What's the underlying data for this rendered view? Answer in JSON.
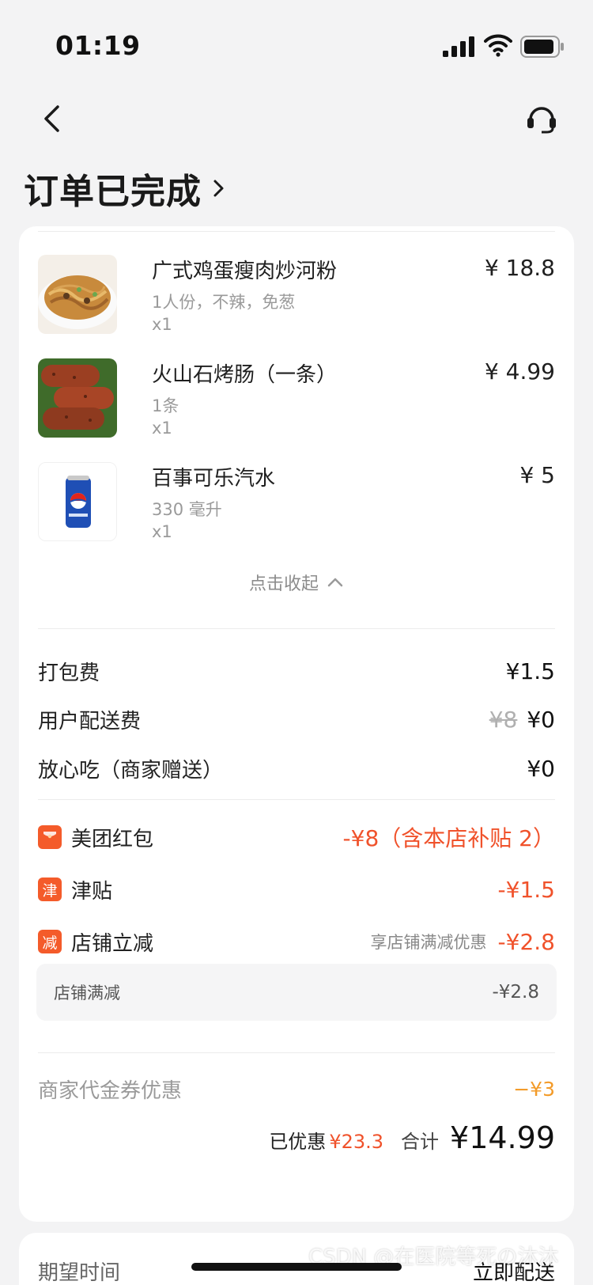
{
  "status_bar": {
    "time": "01:19"
  },
  "header": {
    "title": "订单已完成"
  },
  "items": [
    {
      "name": "广式鸡蛋瘦肉炒河粉",
      "spec": "1人份，不辣，免葱",
      "qty": "x1",
      "price": "¥ 18.8"
    },
    {
      "name": "火山石烤肠（一条）",
      "spec": "1条",
      "qty": "x1",
      "price": "¥ 4.99"
    },
    {
      "name": "百事可乐汽水",
      "spec": "330 毫升",
      "qty": "x1",
      "price": "¥ 5"
    }
  ],
  "collapse_label": "点击收起",
  "fees": [
    {
      "label": "打包费",
      "original": "",
      "value": "¥1.5"
    },
    {
      "label": "用户配送费",
      "original": "¥8",
      "value": "¥0"
    },
    {
      "label": "放心吃（商家赠送）",
      "original": "",
      "value": "¥0"
    }
  ],
  "discounts": [
    {
      "badge": "",
      "label": "美团红包",
      "note": "",
      "amount": "-¥8（含本店补贴 2）"
    },
    {
      "badge": "津",
      "label": "津贴",
      "note": "",
      "amount": "-¥1.5"
    },
    {
      "badge": "减",
      "label": "店铺立减",
      "note": "享店铺满减优惠",
      "amount": "-¥2.8"
    }
  ],
  "sub_discount": {
    "label": "店铺满减",
    "amount": "-¥2.8"
  },
  "voucher": {
    "label": "商家代金券优惠",
    "amount": "−¥3"
  },
  "summary": {
    "saved_label": "已优惠",
    "saved_amount": "¥23.3",
    "total_label": "合计",
    "total_amount": "¥14.99"
  },
  "delivery": {
    "label": "期望时间",
    "value": "立即配送"
  },
  "watermark": "CSDN @在医院等死の沐沐",
  "colors": {
    "accent": "#f0522b",
    "voucher": "#f39b29",
    "background": "#f3f3f4"
  }
}
